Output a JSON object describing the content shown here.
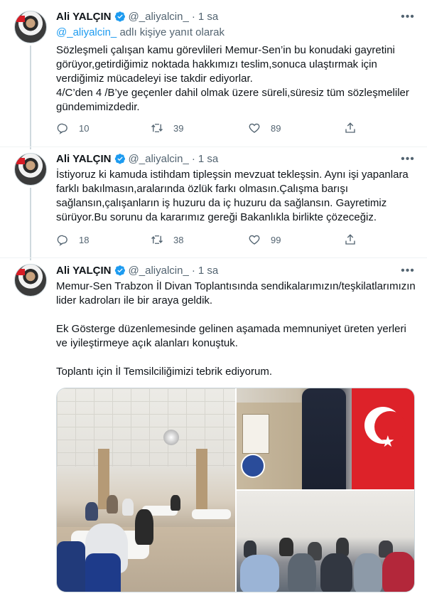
{
  "colors": {
    "link": "#1d9bf0",
    "muted": "#536471",
    "text": "#0f1419",
    "verified": "#1d9bf0"
  },
  "tweets": [
    {
      "name": "Ali YALÇIN",
      "handle": "@_aliyalcin_",
      "dot": "·",
      "time": "1 sa",
      "reply_handle": "@_aliyalcin_",
      "reply_suffix": " adlı kişiye yanıt olarak",
      "text": "Sözleşmeli çalışan kamu görevlileri Memur-Sen’in bu konudaki gayretini görüyor,getirdiğimiz noktada hakkımızı teslim,sonuca ulaştırmak için verdiğimiz mücadeleyi ise takdir ediyorlar.\n4/C’den 4 /B’ye geçenler dahil olmak üzere süreli,süresiz tüm sözleşmeliler gündemimizdedir.",
      "replies": "10",
      "retweets": "39",
      "likes": "89"
    },
    {
      "name": "Ali YALÇIN",
      "handle": "@_aliyalcin_",
      "dot": "·",
      "time": "1 sa",
      "text": "İstiyoruz ki kamuda istihdam tipleşsin mevzuat tekleşsin. Aynı işi yapanlara farklı bakılmasın,aralarında özlük farkı olmasın.Çalışma barışı sağlansın,çalışanların iş huzuru da iç huzuru da sağlansın. Gayretimiz sürüyor.Bu sorunu da kararımız gereği Bakanlıkla birlikte çözeceğiz.",
      "replies": "18",
      "retweets": "38",
      "likes": "99"
    },
    {
      "name": "Ali YALÇIN",
      "handle": "@_aliyalcin_",
      "dot": "·",
      "time": "1 sa",
      "text": "Memur-Sen Trabzon İl Divan Toplantısında sendikalarımızın/teşkilatlarımızın lider kadroları ile bir araya geldik.\n\nEk Gösterge düzenlemesinde gelinen aşamada memnuniyet üreten yerleri ve iyileştirmeye açık alanları konuştuk.\n\nToplantı için İl Temsilciliğimizi tebrik ediyorum."
    }
  ],
  "icons": {
    "reply": "reply-icon",
    "retweet": "retweet-icon",
    "like": "heart-icon",
    "share": "share-icon",
    "more": "more-icon",
    "verified": "verified-badge-icon"
  },
  "more_glyph": "•••"
}
